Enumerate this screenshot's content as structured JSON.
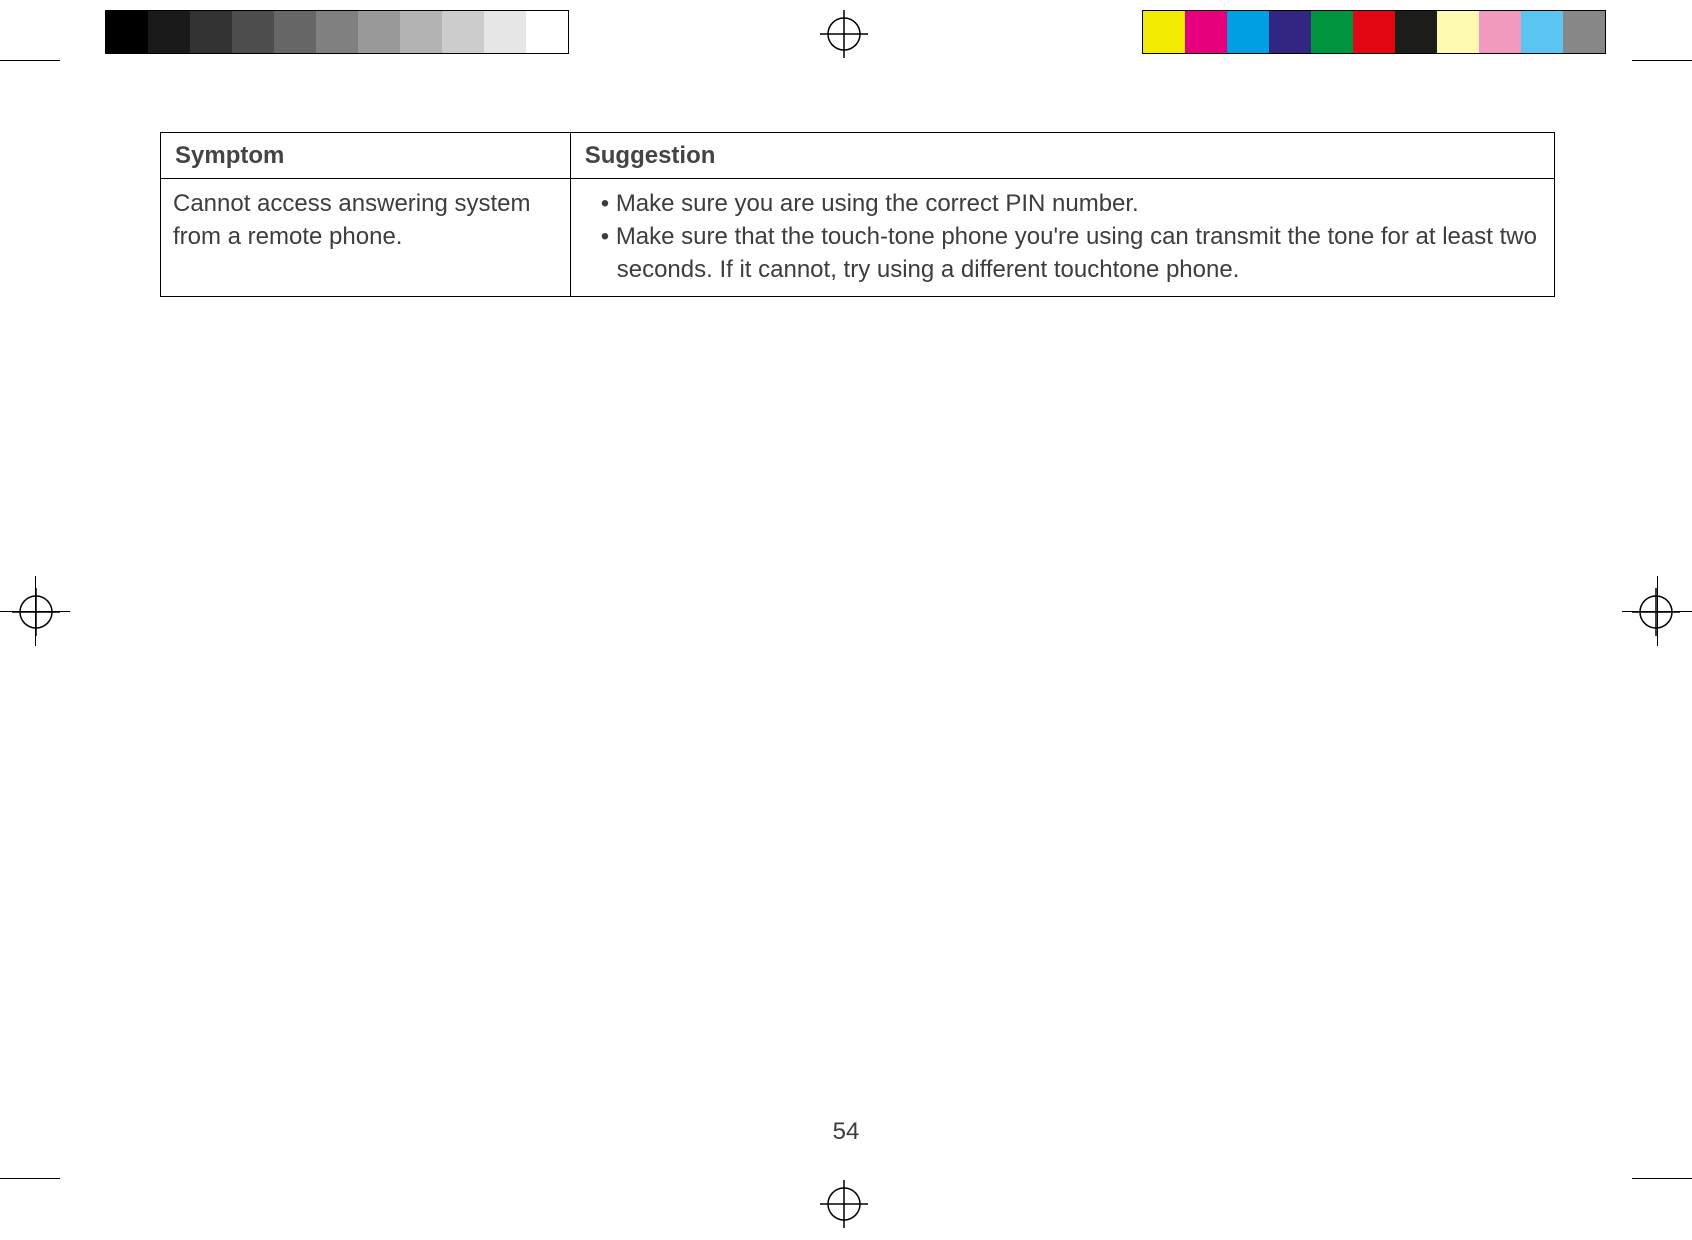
{
  "page_number": "54",
  "table": {
    "headers": {
      "symptom": "Symptom",
      "suggestion": "Suggestion"
    },
    "rows": [
      {
        "symptom": "Cannot access answering system from a remote phone.",
        "suggestions": [
          "Make sure you are using the correct PIN number.",
          "Make sure that the touch-tone phone you're using can transmit the tone for at least two seconds. If it cannot, try using a different touchtone phone."
        ]
      }
    ]
  },
  "calibration": {
    "grayscale": [
      "#000000",
      "#1a1a1a",
      "#333333",
      "#4d4d4d",
      "#666666",
      "#808080",
      "#999999",
      "#b3b3b3",
      "#cccccc",
      "#e6e6e6",
      "#ffffff"
    ],
    "color": [
      "#f2ea00",
      "#e6007e",
      "#009ee3",
      "#312783",
      "#009640",
      "#e30613",
      "#1d1d1b",
      "#fff9b1",
      "#f29ac0",
      "#5bc5f2",
      "#878787"
    ]
  }
}
